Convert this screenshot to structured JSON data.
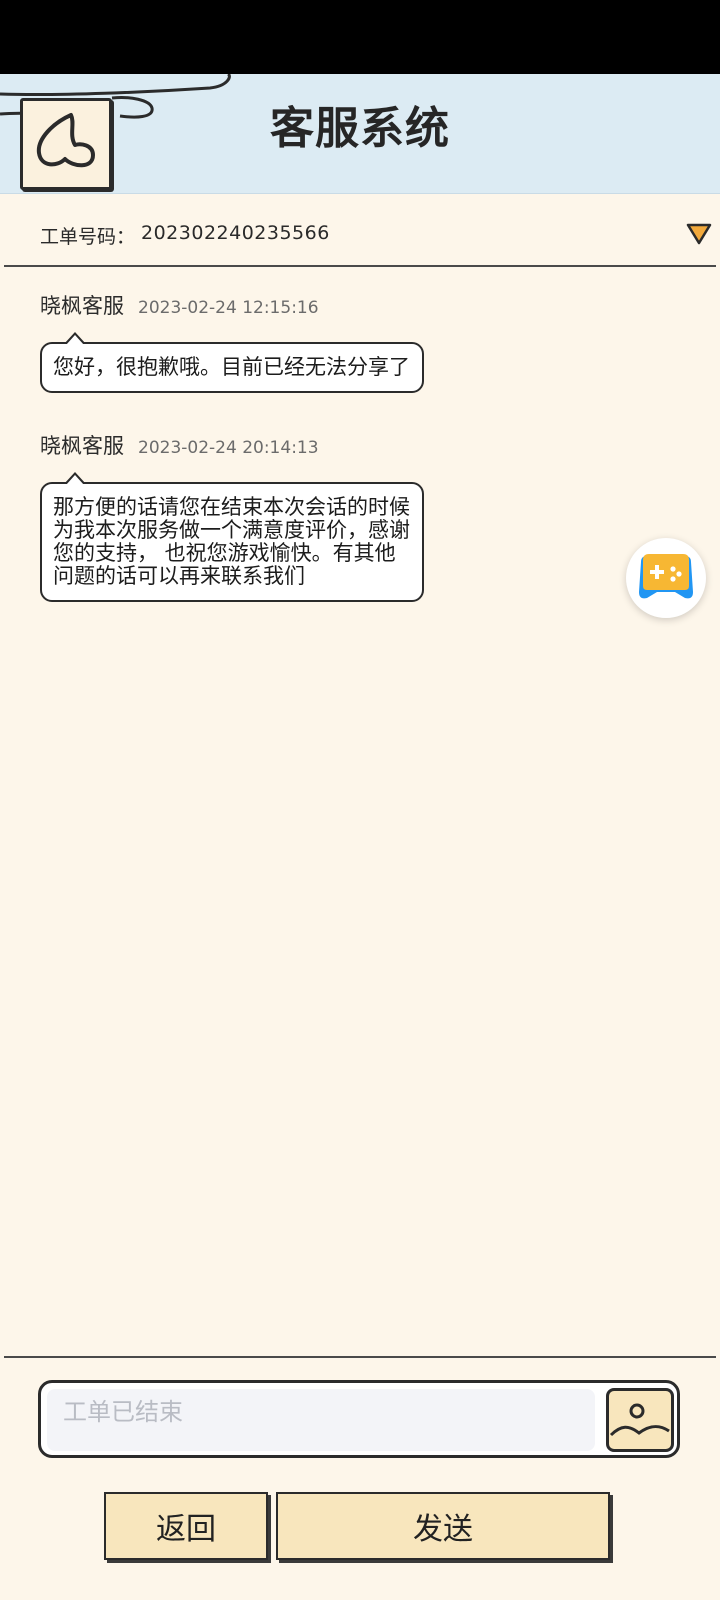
{
  "header": {
    "title": "客服系统"
  },
  "ticket": {
    "label": "工单号码：",
    "number": "202302240235566"
  },
  "messages": [
    {
      "sender": "晓枫客服",
      "time": "2023-02-24 12:15:16",
      "text": "您好，很抱歉哦。目前已经无法分享了"
    },
    {
      "sender": "晓枫客服",
      "time": "2023-02-24 20:14:13",
      "text": "那方便的话请您在结束本次会话的时候为我本次服务做一个满意度评价，感谢您的支持， 也祝您游戏愉快。有其他问题的话可以再来联系我们"
    }
  ],
  "input": {
    "placeholder": "工单已结束",
    "value": ""
  },
  "buttons": {
    "back": "返回",
    "send": "发送"
  },
  "icons": {
    "back": "back-heart-icon",
    "dropdown": "triangle-down-icon",
    "floating": "gamepad-icon",
    "image": "image-icon"
  },
  "colors": {
    "header_bg": "#dcebf3",
    "page_bg": "#fdf6ea",
    "button_bg": "#f8e6bd",
    "dropdown": "#f2a93b"
  }
}
